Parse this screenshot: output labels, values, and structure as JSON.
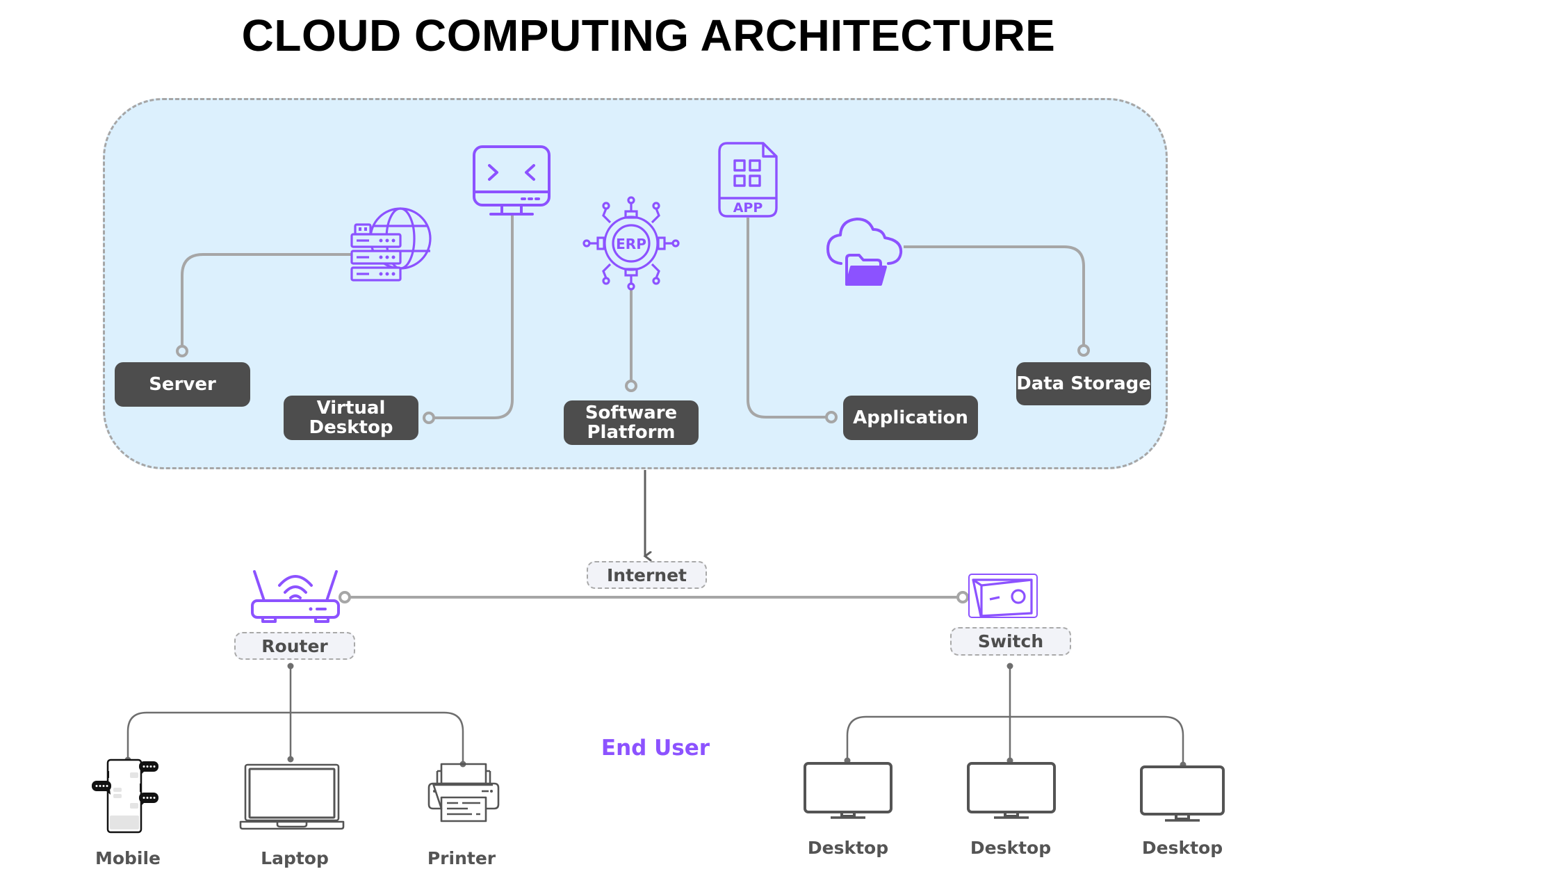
{
  "title": "CLOUD COMPUTING ARCHITECTURE",
  "colors": {
    "accent_purple": "#8c52ff",
    "cloud_fill": "#dcf0fd",
    "node_fill": "#4d4d4d",
    "connector_gray": "#a6a6a6",
    "device_gray": "#545454"
  },
  "cloud_services": [
    {
      "label_line1": "Server",
      "label_line2": "",
      "icon": "server-globe-icon"
    },
    {
      "label_line1": "Virtual",
      "label_line2": "Desktop",
      "icon": "remote-desktop-monitor-icon"
    },
    {
      "label_line1": "Software",
      "label_line2": "Platform",
      "icon": "erp-gear-icon"
    },
    {
      "label_line1": "Application",
      "label_line2": "",
      "icon": "app-file-icon"
    },
    {
      "label_line1": "Data Storage",
      "label_line2": "",
      "icon": "cloud-folder-icon"
    }
  ],
  "erp_icon_text": "ERP",
  "app_icon_text": "APP",
  "network": {
    "internet_label": "Internet",
    "router_label": "Router",
    "switch_label": "Switch"
  },
  "end_user_label": "End User",
  "router_devices": [
    {
      "label": "Mobile",
      "icon": "mobile-chat-icon"
    },
    {
      "label": "Laptop",
      "icon": "laptop-icon"
    },
    {
      "label": "Printer",
      "icon": "printer-icon"
    }
  ],
  "switch_devices": [
    {
      "label": "Desktop",
      "icon": "desktop-monitor-icon"
    },
    {
      "label": "Desktop",
      "icon": "desktop-monitor-icon"
    },
    {
      "label": "Desktop",
      "icon": "desktop-monitor-icon"
    }
  ]
}
